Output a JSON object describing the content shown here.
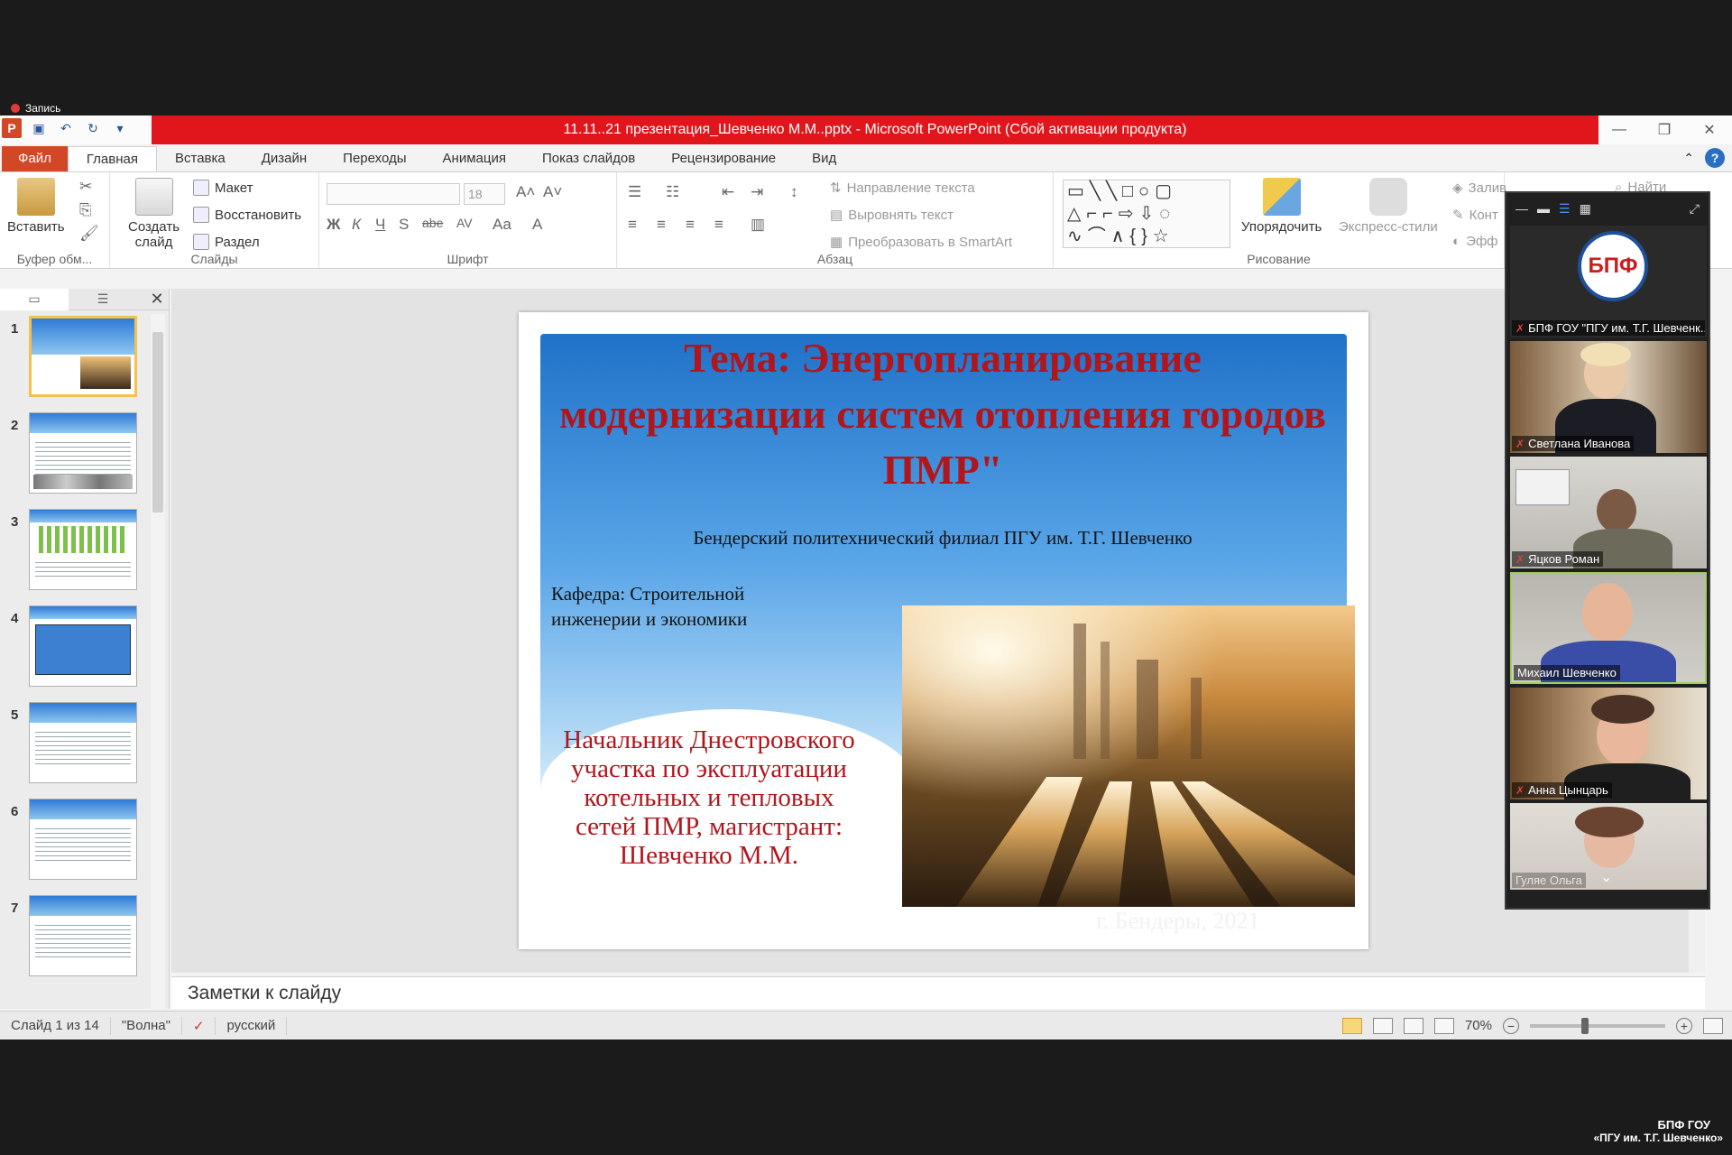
{
  "recording": {
    "label": "Запись"
  },
  "window": {
    "title": "11.11..21 презентация_Шевченко М.М..pptx  -  Microsoft PowerPoint (Сбой активации продукта)",
    "controls": {
      "minimize": "—",
      "restore": "❐",
      "close": "✕"
    }
  },
  "tabs": [
    {
      "label": "Файл"
    },
    {
      "label": "Главная"
    },
    {
      "label": "Вставка"
    },
    {
      "label": "Дизайн"
    },
    {
      "label": "Переходы"
    },
    {
      "label": "Анимация"
    },
    {
      "label": "Показ слайдов"
    },
    {
      "label": "Рецензирование"
    },
    {
      "label": "Вид"
    }
  ],
  "ribbon": {
    "clipboard": {
      "paste": "Вставить",
      "label": "Буфер обм..."
    },
    "slides": {
      "create": "Создать",
      "create2": "слайд",
      "layout": "Макет",
      "reset": "Восстановить",
      "section": "Раздел",
      "label": "Слайды"
    },
    "font": {
      "size": "18",
      "bold": "Ж",
      "italic": "К",
      "underline": "Ч",
      "strike": "S",
      "abc": "abe",
      "av": "AV",
      "case": "Aa",
      "color": "A",
      "label": "Шрифт"
    },
    "paragraph": {
      "direction": "Направление текста",
      "align": "Выровнять текст",
      "smartart": "Преобразовать в SmartArt",
      "label": "Абзац"
    },
    "drawing": {
      "arrange": "Упорядочить",
      "quickstyles": "Экспресс-стили",
      "fill": "Залив",
      "outline": "Конт",
      "effects": "Эфф",
      "label": "Рисование"
    },
    "editing": {
      "find": "Найти"
    }
  },
  "slides_panel": {
    "thumbnails": [
      {
        "num": "1"
      },
      {
        "num": "2"
      },
      {
        "num": "3"
      },
      {
        "num": "4"
      },
      {
        "num": "5"
      },
      {
        "num": "6"
      },
      {
        "num": "7"
      }
    ]
  },
  "slide": {
    "title": "Тема: Энергопланирование модернизации систем отопления городов ПМР\"",
    "subtitle": "Бендерский политехнический  филиал  ПГУ им. Т.Г. Шевченко",
    "dept": "Кафедра: Строительной инженерии  и экономики",
    "author": "Начальник  Днестровского участка по эксплуатации котельных  и тепловых сетей  ПМР, магистрант: Шевченко М.М.",
    "city": "г. Бендеры, 2021"
  },
  "notes": {
    "placeholder": "Заметки к слайду"
  },
  "status": {
    "slide_of": "Слайд 1 из 14",
    "theme": "\"Волна\"",
    "lang": "русский",
    "zoom": "70%",
    "zoom_level": 0.4
  },
  "video": {
    "participants": [
      {
        "name": "БПФ ГОУ \"ПГУ им. Т.Г. Шевченк..."
      },
      {
        "name": "Светлана Иванова"
      },
      {
        "name": "Яцков Роман"
      },
      {
        "name": "Михаил Шевченко"
      },
      {
        "name": "Анна Цынцарь"
      },
      {
        "name": "Гуляе Ольга"
      }
    ],
    "logo_text": "БПФ"
  },
  "watermark": {
    "line1": "БПФ ГОУ",
    "line2": "«ПГУ им. Т.Г. Шевченко»"
  },
  "colors": {
    "titlebar": "#e0161c",
    "file_tab": "#d24726",
    "slide_title": "#b0161c"
  }
}
